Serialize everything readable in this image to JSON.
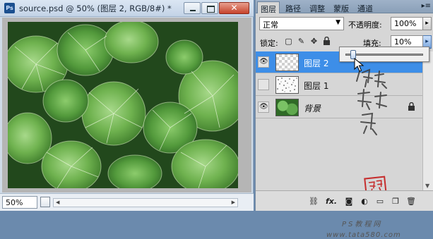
{
  "document": {
    "title": "source.psd @ 50% (图层 2, RGB/8#) *",
    "app_icon": "Ps",
    "zoom": "50%",
    "close_glyph": "✕"
  },
  "panel": {
    "tabs": [
      {
        "label": "图层",
        "active": true
      },
      {
        "label": "路径",
        "active": false
      },
      {
        "label": "调整",
        "active": false
      },
      {
        "label": "蒙版",
        "active": false
      },
      {
        "label": "通道",
        "active": false
      }
    ],
    "tab_menu": "▸≡",
    "blend_mode": "正常",
    "opacity_label": "不透明度:",
    "opacity_value": "100%",
    "lock_label": "锁定:",
    "fill_label": "填充:",
    "fill_value": "10%",
    "fill_slider_fraction": 0.1,
    "layers": [
      {
        "name": "图层 2",
        "visible": true,
        "selected": true,
        "thumb": "transparent"
      },
      {
        "name": "图层 1",
        "visible": false,
        "selected": false,
        "thumb": "speckle"
      },
      {
        "name": "背景",
        "visible": true,
        "selected": false,
        "thumb": "photo",
        "locked": true
      }
    ],
    "bottom_icons": [
      "link-icon",
      "fx-icon",
      "mask-icon",
      "adjustment-icon",
      "group-icon",
      "new-layer-icon",
      "trash-icon"
    ],
    "fx_label": "fx."
  },
  "overlay": {
    "seal_text": "郑州",
    "watermark_cn": "PS教程网",
    "watermark_url": "www.tata580.com"
  },
  "colors": {
    "selection": "#3d8ee8",
    "seal": "#c62d2d"
  }
}
